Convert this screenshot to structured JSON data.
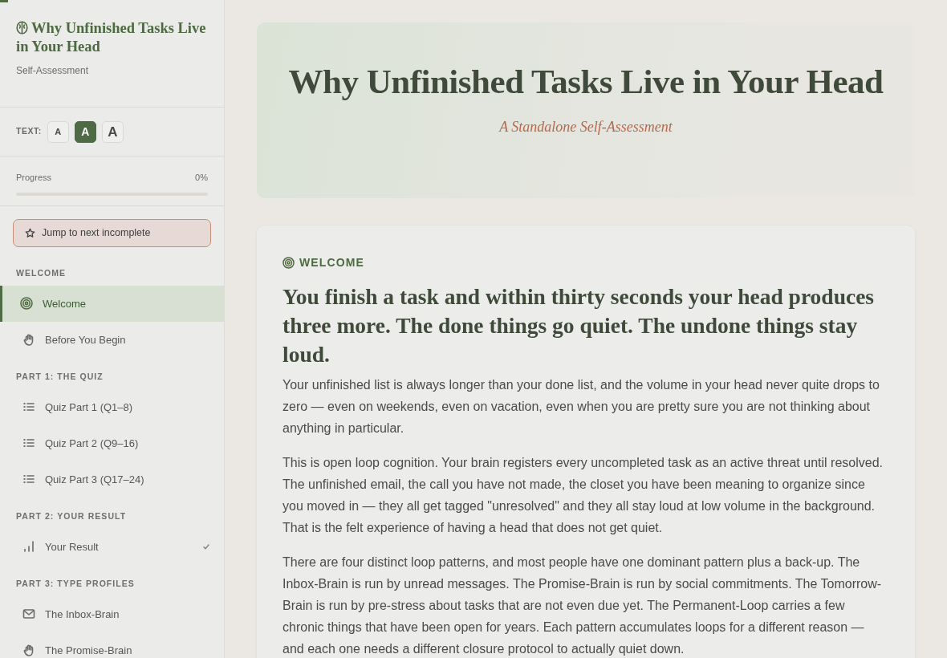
{
  "sidebar": {
    "title": "Why Unfinished Tasks Live in Your Head",
    "subtitle": "Self-Assessment",
    "text_size": {
      "label": "TEXT:",
      "options": [
        {
          "label": "A",
          "selected": false
        },
        {
          "label": "A",
          "selected": true
        },
        {
          "label": "A",
          "selected": false
        }
      ]
    },
    "progress": {
      "label": "Progress",
      "reading": "0%",
      "level": 0
    },
    "jump_button": "Jump to next incomplete",
    "sections": [
      {
        "heading": "WELCOME",
        "items": [
          {
            "label": "Welcome",
            "kind": "welcome",
            "selected": true,
            "done": false
          },
          {
            "label": "Before You Begin",
            "kind": "prep",
            "selected": false,
            "done": false
          }
        ]
      },
      {
        "heading": "PART 1: THE QUIZ",
        "items": [
          {
            "label": "Quiz Part 1 (Q1–8)",
            "kind": "quiz",
            "selected": false,
            "done": false
          },
          {
            "label": "Quiz Part 2 (Q9–16)",
            "kind": "quiz",
            "selected": false,
            "done": false
          },
          {
            "label": "Quiz Part 3 (Q17–24)",
            "kind": "quiz",
            "selected": false,
            "done": false
          }
        ]
      },
      {
        "heading": "PART 2: YOUR RESULT",
        "items": [
          {
            "label": "Your Result",
            "kind": "result",
            "selected": false,
            "done": true
          }
        ]
      },
      {
        "heading": "PART 3: TYPE PROFILES",
        "items": [
          {
            "label": "The Inbox-Brain",
            "kind": "inbox",
            "selected": false,
            "done": false
          },
          {
            "label": "The Promise-Brain",
            "kind": "promise",
            "selected": false,
            "done": false
          }
        ]
      }
    ]
  },
  "hero": {
    "title": "Why Unfinished Tasks Live in Your Head",
    "subtitle": "A Standalone Self-Assessment"
  },
  "content": {
    "eyebrow": "WELCOME",
    "heading": "You finish a task and within thirty seconds your head produces three more. The done things go quiet. The undone things stay loud.",
    "paragraphs": [
      "Your unfinished list is always longer than your done list, and the volume in your head never quite drops to zero — even on weekends, even on vacation, even when you are pretty sure you are not thinking about anything in particular.",
      "This is open loop cognition. Your brain registers every uncompleted task as an active threat until resolved. The unfinished email, the call you have not made, the closet you have been meaning to organize since you moved in — they all get tagged \"unresolved\" and they all stay loud at low volume in the background. That is the felt experience of having a head that does not get quiet.",
      "There are four distinct loop patterns, and most people have one dominant pattern plus a back-up. The Inbox-Brain is run by unread messages. The Promise-Brain is run by social commitments. The Tomorrow-Brain is run by pre-stress about tasks that are not even due yet. The Permanent-Loop carries a few chronic things that have been open for years. Each pattern accumulates loops for a different reason — and each one needs a different closure protocol to actually quiet down."
    ]
  }
}
